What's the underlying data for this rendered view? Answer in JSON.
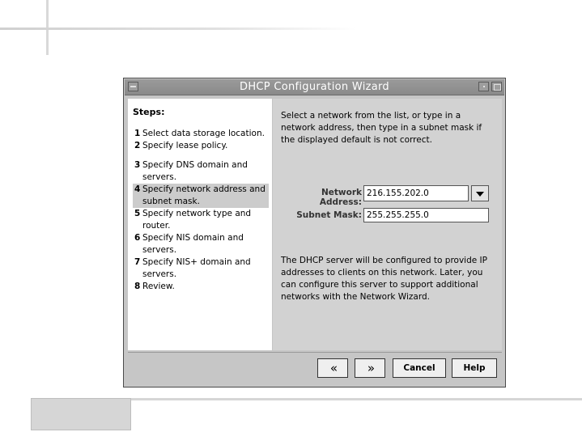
{
  "window": {
    "title": "DHCP Configuration Wizard"
  },
  "steps": {
    "title": "Steps:",
    "items": [
      {
        "num": "1",
        "text": "Select data storage location."
      },
      {
        "num": "2",
        "text": "Specify lease policy."
      },
      {
        "num": "3",
        "text": "Specify DNS domain and servers."
      },
      {
        "num": "4",
        "text": "Specify network address and subnet mask."
      },
      {
        "num": "5",
        "text": "Specify network type and router."
      },
      {
        "num": "6",
        "text": "Specify NIS domain and servers."
      },
      {
        "num": "7",
        "text": "Specify NIS+ domain and servers."
      },
      {
        "num": "8",
        "text": "Review."
      }
    ]
  },
  "content": {
    "intro": "Select a network from the list, or type in a network address, then type in a subnet mask if the displayed default is not correct.",
    "network_address_label": "Network Address:",
    "network_address_value": "216.155.202.0",
    "subnet_mask_label": "Subnet Mask:",
    "subnet_mask_value": "255.255.255.0",
    "info": "The DHCP server will be configured to provide IP addresses to clients on this network.  Later, you can configure this server to support additional networks with the Network Wizard."
  },
  "buttons": {
    "back_glyph": "«",
    "next_glyph": "»",
    "cancel": "Cancel",
    "help": "Help"
  }
}
